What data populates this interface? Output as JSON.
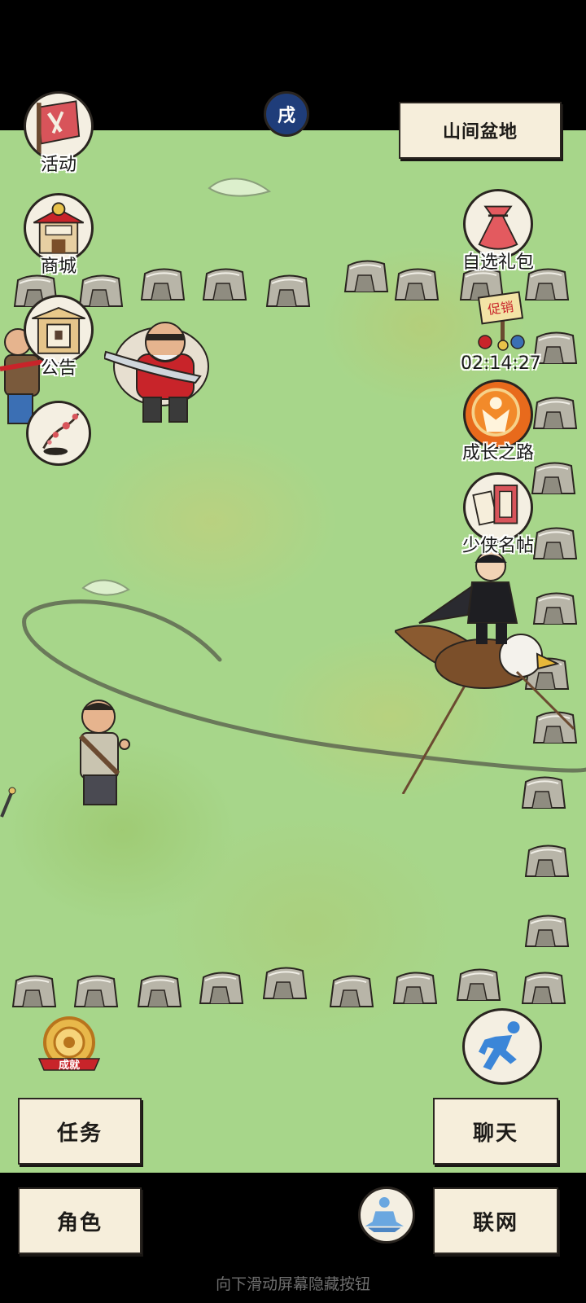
{
  "location": {
    "name": "山间盆地"
  },
  "left_menu": [
    {
      "label": "活动",
      "icon": "banner-icon"
    },
    {
      "label": "商城",
      "icon": "shop-icon"
    },
    {
      "label": "公告",
      "icon": "notice-board-icon"
    }
  ],
  "right_menu": {
    "gift": {
      "label": "自选礼包",
      "icon": "gift-bag-icon"
    },
    "sale": {
      "timer": "02:14:27",
      "icon": "sale-sign-icon",
      "sign_text": "促销"
    },
    "growth": {
      "label": "成长之路",
      "icon": "growth-sun-icon"
    },
    "roster": {
      "label": "少侠名帖",
      "icon": "name-card-icon"
    }
  },
  "achievement": {
    "label": "成就"
  },
  "bottom_buttons": {
    "tasks": "任务",
    "chat": "聊天",
    "character": "角色",
    "network": "联网"
  },
  "hint": "向下滑动屏幕隐藏按钮",
  "top_badge": {
    "text": "戌"
  },
  "colors": {
    "map": "#a7d68a",
    "paper": "#f6eedb",
    "outline": "#2a2520"
  }
}
